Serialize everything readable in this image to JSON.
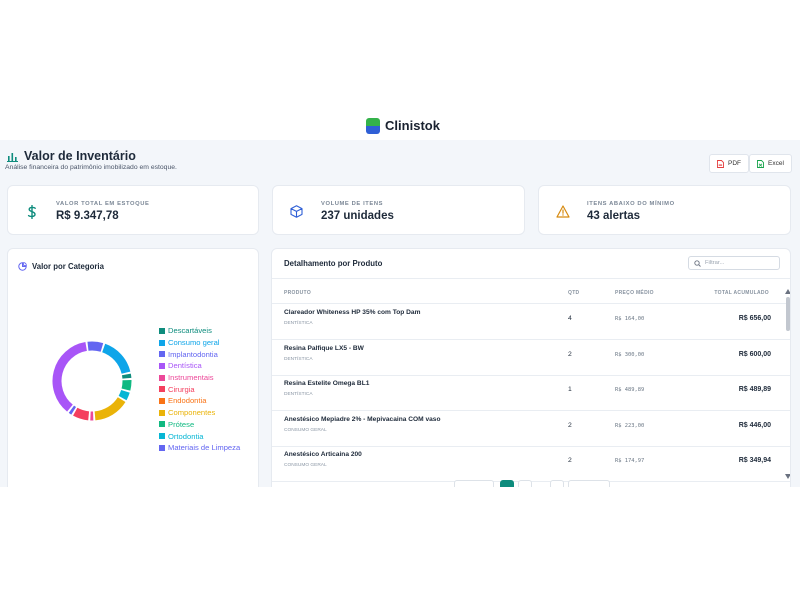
{
  "brand": {
    "name": "Clinistok"
  },
  "page": {
    "title": "Valor de Inventário",
    "subtitle": "Análise financeira do patrimônio imobilizado em estoque."
  },
  "exports": {
    "pdf": "PDF",
    "excel": "Excel"
  },
  "stats": [
    {
      "label": "VALOR TOTAL EM ESTOQUE",
      "value": "R$ 9.347,78",
      "icon": "dollar-icon",
      "color": "#0e8c7d",
      "bg": "#e3f5f2"
    },
    {
      "label": "VOLUME DE ITENS",
      "value": "237 unidades",
      "icon": "box-icon",
      "color": "#2f5fd6",
      "bg": "#e7eefc"
    },
    {
      "label": "ITENS ABAIXO DO MÍNIMO",
      "value": "43 alertas",
      "icon": "warning-icon",
      "color": "#d68a10",
      "bg": "#fdf2df"
    }
  ],
  "category_card": {
    "title": "Valor por Categoria",
    "legend": [
      {
        "label": "Descartáveis",
        "color": "#0e8c7d"
      },
      {
        "label": "Consumo geral",
        "color": "#0ea5e9"
      },
      {
        "label": "Implantodontia",
        "color": "#6366f1"
      },
      {
        "label": "Dentística",
        "color": "#a855f7"
      },
      {
        "label": "Instrumentais",
        "color": "#ec4899"
      },
      {
        "label": "Cirurgia",
        "color": "#f43f5e"
      },
      {
        "label": "Endodontia",
        "color": "#f97316"
      },
      {
        "label": "Componentes",
        "color": "#eab308"
      },
      {
        "label": "Prótese",
        "color": "#10b981"
      },
      {
        "label": "Ortodontia",
        "color": "#06b6d4"
      },
      {
        "label": "Materiais de Limpeza",
        "color": "#6366f1"
      }
    ]
  },
  "chart_data": {
    "type": "pie",
    "donut": true,
    "title": "Valor por Categoria",
    "slices": [
      {
        "label": "Consumo geral",
        "value": 16,
        "color": "#0ea5e9"
      },
      {
        "label": "Descartáveis",
        "value": 2.5,
        "color": "#0e8c7d"
      },
      {
        "label": "Prótese",
        "value": 5,
        "color": "#10b981"
      },
      {
        "label": "Ortodontia",
        "value": 4,
        "color": "#06b6d4"
      },
      {
        "label": "Componentes",
        "value": 15,
        "color": "#eab308"
      },
      {
        "label": "Instrumentais",
        "value": 2,
        "color": "#ec4899"
      },
      {
        "label": "Cirurgia",
        "value": 7,
        "color": "#f43f5e"
      },
      {
        "label": "Materiais de Limpeza",
        "value": 2,
        "color": "#6366f1"
      },
      {
        "label": "Dentística",
        "value": 36,
        "color": "#a855f7"
      },
      {
        "label": "Implantodontia",
        "value": 7,
        "color": "#6366f1"
      }
    ]
  },
  "products_card": {
    "title": "Detalhamento por Produto",
    "search_placeholder": "Filtrar...",
    "columns": {
      "product": "PRODUTO",
      "qty": "QTD",
      "avg_price": "PREÇO MÉDIO",
      "total": "TOTAL ACUMULADO"
    },
    "rows": [
      {
        "name": "Clareador Whiteness HP 35% com Top Dam",
        "category": "DENTÍSTICA",
        "qty": "4",
        "avg_price": "R$ 164,00",
        "total": "R$ 656,00"
      },
      {
        "name": "Resina Palfique LX5 - BW",
        "category": "DENTÍSTICA",
        "qty": "2",
        "avg_price": "R$ 300,00",
        "total": "R$ 600,00"
      },
      {
        "name": "Resina Estelite Omega BL1",
        "category": "DENTÍSTICA",
        "qty": "1",
        "avg_price": "R$ 489,89",
        "total": "R$ 489,89"
      },
      {
        "name": "Anestésico Mepiadre 2% - Mepivacaina COM vaso",
        "category": "CONSUMO GERAL",
        "qty": "2",
        "avg_price": "R$ 223,00",
        "total": "R$ 446,00"
      },
      {
        "name": "Anestésico Articaina 200",
        "category": "CONSUMO GERAL",
        "qty": "2",
        "avg_price": "R$ 174,97",
        "total": "R$ 349,94"
      }
    ]
  }
}
